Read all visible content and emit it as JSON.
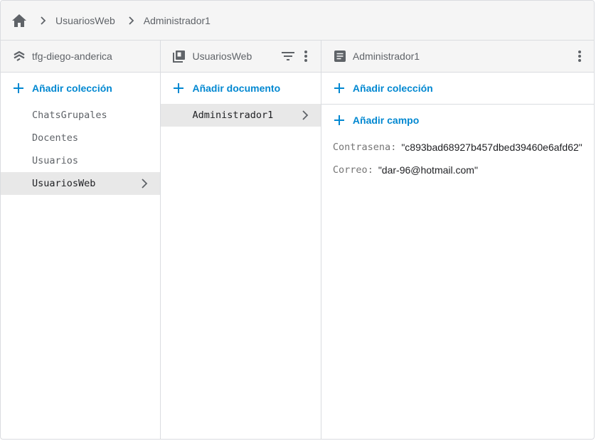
{
  "breadcrumb": {
    "home_icon": "home-icon",
    "items": [
      "UsuariosWeb",
      "Administrador1"
    ]
  },
  "project_panel": {
    "title": "tfg-diego-anderica",
    "icon": "firestore-icon",
    "add_label": "Añadir colección",
    "items": [
      "ChatsGrupales",
      "Docentes",
      "Usuarios",
      "UsuariosWeb"
    ],
    "selected": "UsuariosWeb"
  },
  "collection_panel": {
    "title": "UsuariosWeb",
    "icon": "collection-icon",
    "add_label": "Añadir documento",
    "items": [
      "Administrador1"
    ],
    "selected": "Administrador1"
  },
  "document_panel": {
    "title": "Administrador1",
    "icon": "document-icon",
    "add_collection_label": "Añadir colección",
    "add_field_label": "Añadir campo",
    "fields": [
      {
        "key": "Contrasena",
        "value": "\"c893bad68927b457dbed39460e6afd62\""
      },
      {
        "key": "Correo",
        "value": "\"dar-96@hotmail.com\""
      }
    ]
  },
  "colors": {
    "accent": "#0288d1",
    "header_bg": "#f5f5f5",
    "selected_bg": "#e8e8e8",
    "border": "#dadce0"
  }
}
